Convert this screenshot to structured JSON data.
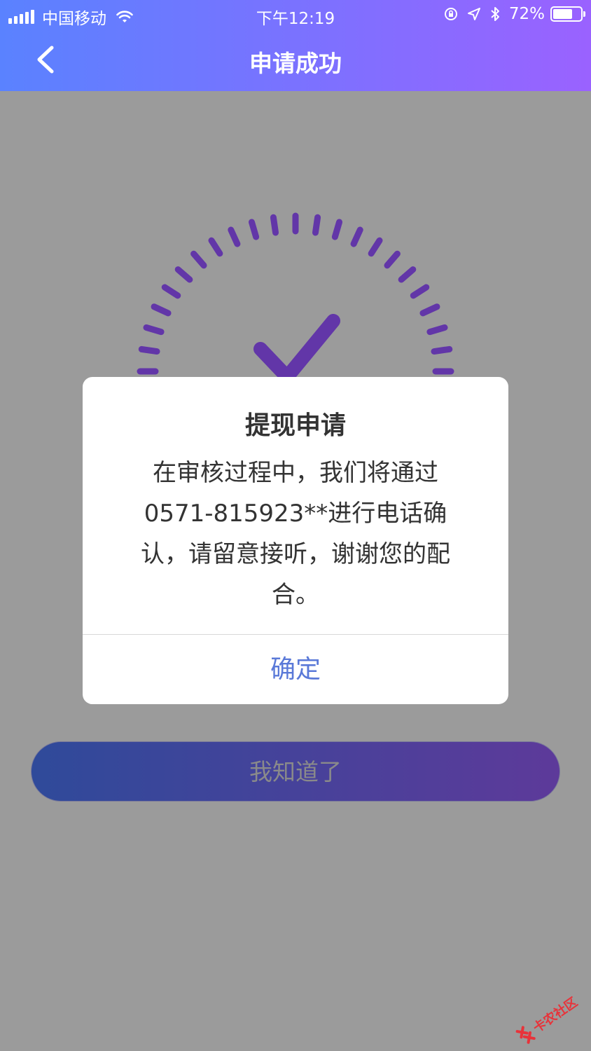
{
  "status_bar": {
    "carrier": "中国移动",
    "time": "下午12:19",
    "battery_text": "72%",
    "battery_level": 0.72
  },
  "nav": {
    "title": "申请成功",
    "back_icon": "chevron-left-icon"
  },
  "success_graphic": {
    "icon": "checkmark-icon",
    "accent_color": "#6236a8"
  },
  "modal": {
    "title": "提现申请",
    "message_lines": [
      "在审核过程中，我们将通过",
      "0571-815923**进行电话确",
      "认，请留意接听，谢谢您的配",
      "合。"
    ],
    "confirm_label": "确定",
    "confirm_color": "#5a79d8"
  },
  "main_button": {
    "label": "我知道了"
  },
  "watermark": {
    "text": "卡农社区"
  }
}
